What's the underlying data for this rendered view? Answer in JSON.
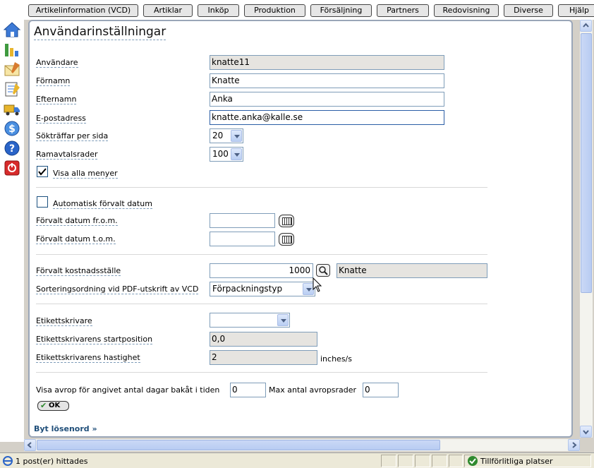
{
  "tabs": [
    "Artikelinformation (VCD)",
    "Artiklar",
    "Inköp",
    "Produktion",
    "Försäljning",
    "Partners",
    "Redovisning",
    "Diverse",
    "Hjälp"
  ],
  "sidebar_icons": [
    "home-icon",
    "bar-chart-icon",
    "envelope-icon",
    "notepad-icon",
    "truck-icon",
    "dollar-icon",
    "help-icon",
    "power-icon"
  ],
  "page": {
    "title": "Användarinställningar",
    "fields": {
      "user": {
        "label": "Användare",
        "value": "knatte11"
      },
      "firstname": {
        "label": "Förnamn",
        "value": "Knatte"
      },
      "lastname": {
        "label": "Efternamn",
        "value": "Anka"
      },
      "email": {
        "label": "E-postadress",
        "value": "knatte.anka@kalle.se"
      },
      "hits": {
        "label": "Sökträffar per sida",
        "value": "20"
      },
      "frame": {
        "label": "Ramavtalsrader",
        "value": "100"
      },
      "show_menus": {
        "label": "Visa alla menyer",
        "checked": true
      },
      "auto_date": {
        "label": "Automatisk förvalt datum",
        "checked": false
      },
      "date_from": {
        "label": "Förvalt datum fr.o.m.",
        "value": ""
      },
      "date_to": {
        "label": "Förvalt datum t.o.m.",
        "value": ""
      },
      "cost_center": {
        "label": "Förvalt kostnadsställe",
        "value": "1000",
        "name": "Knatte"
      },
      "sort_order": {
        "label": "Sorteringsordning vid PDF-utskrift av VCD",
        "value": "Förpackningstyp"
      },
      "printer": {
        "label": "Etikettskrivare",
        "value": ""
      },
      "printer_start": {
        "label": "Etikettskrivarens startposition",
        "value": "0,0"
      },
      "printer_speed": {
        "label": "Etikettskrivarens hastighet",
        "value": "2",
        "unit": "inches/s"
      },
      "avrop_days": {
        "label": "Visa avrop för angivet antal dagar bakåt i tiden",
        "value": "0"
      },
      "avrop_max": {
        "label": "Max antal avropsrader",
        "value": "0"
      }
    },
    "ok_label": "OK",
    "password_link": "Byt lösenord »"
  },
  "status": {
    "left": "1 post(er) hittades",
    "zone": "Tillförlitliga platser"
  }
}
